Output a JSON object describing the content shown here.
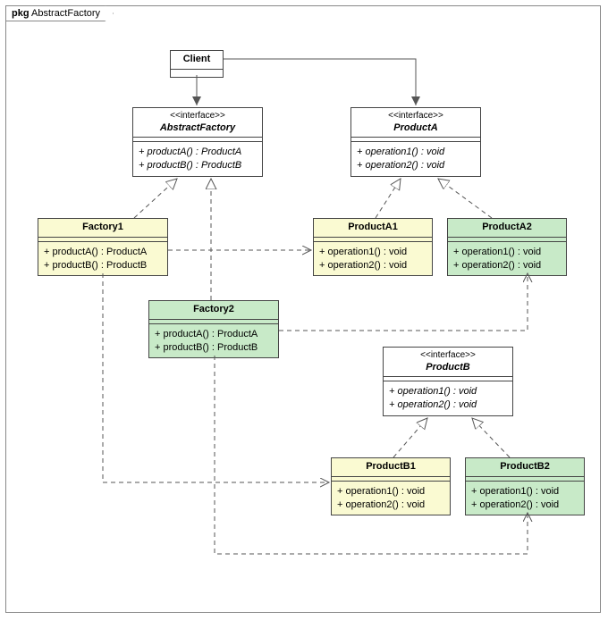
{
  "package": {
    "label_prefix": "pkg",
    "name": "AbstractFactory"
  },
  "client": {
    "name": "Client"
  },
  "abstractFactory": {
    "stereo": "<<interface>>",
    "name": "AbstractFactory",
    "ops": [
      "+ productA() : ProductA",
      "+ productB() : ProductB"
    ]
  },
  "productA": {
    "stereo": "<<interface>>",
    "name": "ProductA",
    "ops": [
      "+ operation1() : void",
      "+ operation2() : void"
    ]
  },
  "productB": {
    "stereo": "<<interface>>",
    "name": "ProductB",
    "ops": [
      "+ operation1() : void",
      "+ operation2() : void"
    ]
  },
  "factory1": {
    "name": "Factory1",
    "ops": [
      "+ productA() : ProductA",
      "+ productB() : ProductB"
    ]
  },
  "factory2": {
    "name": "Factory2",
    "ops": [
      "+ productA() : ProductA",
      "+ productB() : ProductB"
    ]
  },
  "productA1": {
    "name": "ProductA1",
    "ops": [
      "+ operation1() : void",
      "+ operation2() : void"
    ]
  },
  "productA2": {
    "name": "ProductA2",
    "ops": [
      "+ operation1() : void",
      "+ operation2() : void"
    ]
  },
  "productB1": {
    "name": "ProductB1",
    "ops": [
      "+ operation1() : void",
      "+ operation2() : void"
    ]
  },
  "productB2": {
    "name": "ProductB2",
    "ops": [
      "+ operation1() : void",
      "+ operation2() : void"
    ]
  }
}
